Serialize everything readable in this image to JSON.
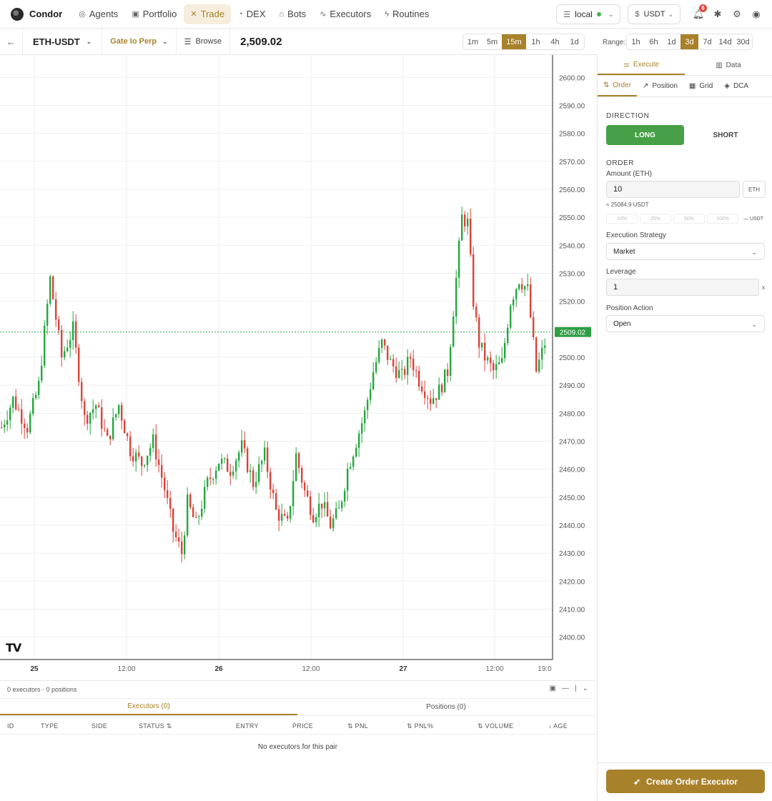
{
  "app": {
    "name": "Condor"
  },
  "nav": [
    {
      "label": "Agents",
      "icon": "agents-icon",
      "glyph": "◎"
    },
    {
      "label": "Portfolio",
      "icon": "briefcase-icon",
      "glyph": "▣"
    },
    {
      "label": "Trade",
      "icon": "trade-icon",
      "glyph": "✕",
      "active": true
    },
    {
      "label": "DEX",
      "icon": "dex-icon",
      "glyph": "◔"
    },
    {
      "label": "Bots",
      "icon": "bot-icon",
      "glyph": "⌂"
    },
    {
      "label": "Executors",
      "icon": "activity-icon",
      "glyph": "∿"
    },
    {
      "label": "Routines",
      "icon": "zap-icon",
      "glyph": "ϟ"
    }
  ],
  "top_right": {
    "server": "local",
    "currency": "USDT",
    "notifications": "6"
  },
  "toolbar": {
    "pair": "ETH-USDT",
    "exchange": "Gate Io Perp",
    "browse": "Browse",
    "price": "2,509.02",
    "timeframes": [
      "1m",
      "5m",
      "15m",
      "1h",
      "4h",
      "1d"
    ],
    "active_timeframe": "15m",
    "range_label": "Range:",
    "ranges": [
      "1h",
      "6h",
      "1d",
      "3d",
      "7d",
      "14d",
      "30d"
    ],
    "active_range": "3d"
  },
  "chart_data": {
    "type": "candlestick",
    "symbol": "ETH-USDT",
    "interval": "15m",
    "y_ticks": [
      "2600.00",
      "2590.00",
      "2580.00",
      "2570.00",
      "2560.00",
      "2550.00",
      "2540.00",
      "2530.00",
      "2520.00",
      "2510.00",
      "2500.00",
      "2490.00",
      "2480.00",
      "2470.00",
      "2460.00",
      "2450.00",
      "2440.00",
      "2430.00",
      "2420.00",
      "2410.00",
      "2400.00"
    ],
    "ylim": [
      2392,
      2608
    ],
    "x_ticks": [
      "25",
      "12:00",
      "26",
      "12:00",
      "27",
      "12:00",
      "19:0"
    ],
    "last_price": 2509.02,
    "last_price_label": "2509.02",
    "up_color": "#26a641",
    "down_color": "#d9433a",
    "path": [
      [
        0,
        2475
      ],
      [
        4,
        2485
      ],
      [
        9,
        2475
      ],
      [
        13,
        2490
      ],
      [
        17,
        2528
      ],
      [
        21,
        2500
      ],
      [
        25,
        2510
      ],
      [
        29,
        2478
      ],
      [
        33,
        2483
      ],
      [
        37,
        2470
      ],
      [
        41,
        2483
      ],
      [
        45,
        2467
      ],
      [
        49,
        2462
      ],
      [
        53,
        2470
      ],
      [
        57,
        2453
      ],
      [
        60,
        2438
      ],
      [
        63,
        2430
      ],
      [
        65,
        2448
      ],
      [
        68,
        2440
      ],
      [
        72,
        2455
      ],
      [
        76,
        2463
      ],
      [
        80,
        2460
      ],
      [
        84,
        2468
      ],
      [
        88,
        2455
      ],
      [
        92,
        2465
      ],
      [
        96,
        2445
      ],
      [
        100,
        2440
      ],
      [
        103,
        2465
      ],
      [
        106,
        2452
      ],
      [
        109,
        2444
      ],
      [
        112,
        2448
      ],
      [
        115,
        2440
      ],
      [
        118,
        2445
      ],
      [
        121,
        2460
      ],
      [
        124,
        2470
      ],
      [
        127,
        2480
      ],
      [
        130,
        2495
      ],
      [
        133,
        2505
      ],
      [
        136,
        2498
      ],
      [
        140,
        2493
      ],
      [
        143,
        2500
      ],
      [
        146,
        2492
      ],
      [
        150,
        2485
      ],
      [
        153,
        2488
      ],
      [
        156,
        2495
      ],
      [
        159,
        2528
      ],
      [
        161,
        2550
      ],
      [
        163,
        2548
      ],
      [
        165,
        2520
      ],
      [
        167,
        2505
      ],
      [
        169,
        2500
      ],
      [
        172,
        2495
      ],
      [
        175,
        2498
      ],
      [
        178,
        2520
      ],
      [
        181,
        2528
      ],
      [
        184,
        2524
      ],
      [
        187,
        2495
      ],
      [
        190,
        2505
      ]
    ]
  },
  "bottom": {
    "summary": "0 executors · 0 positions",
    "tabs": [
      "Executors (0)",
      "Positions (0)"
    ],
    "columns": [
      "ID",
      "TYPE",
      "SIDE",
      "STATUS ⇅",
      "ENTRY",
      "PRICE",
      "⇅ PNL",
      "⇅ PNL%",
      "⇅ VOLUME",
      "↓ AGE"
    ],
    "empty": "No executors for this pair"
  },
  "panel": {
    "tabs": [
      "Execute",
      "Data"
    ],
    "order_tabs": [
      "Order",
      "Position",
      "Grid",
      "DCA"
    ],
    "direction_label": "DIRECTION",
    "long": "LONG",
    "short": "SHORT",
    "order_label": "ORDER",
    "amount_label": "Amount (ETH)",
    "amount": "10",
    "amount_unit": "ETH",
    "conversion": "≈ 25084.9 USDT",
    "percents": [
      "10%",
      "25%",
      "50%",
      "100%"
    ],
    "pct_unit": "— USDT",
    "strategy_label": "Execution Strategy",
    "strategy": "Market",
    "leverage_label": "Leverage",
    "leverage": "1",
    "leverage_unit": "x",
    "position_action_label": "Position Action",
    "position_action": "Open",
    "create_button": "Create Order Executor"
  }
}
